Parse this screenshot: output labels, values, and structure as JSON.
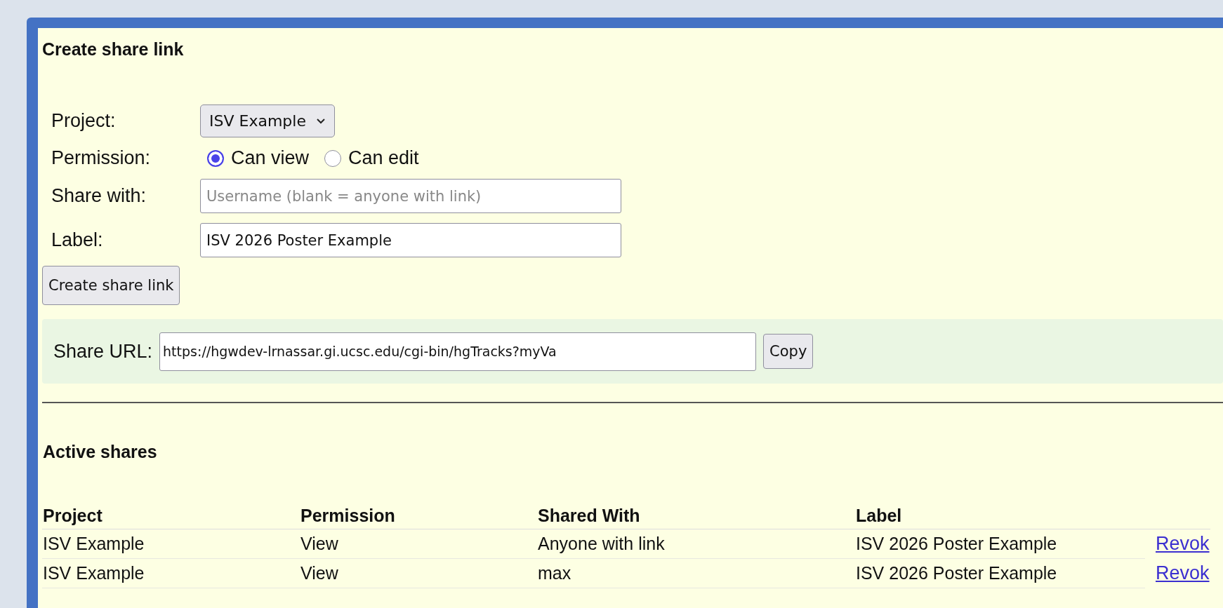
{
  "create_section": {
    "title": "Create share link",
    "project": {
      "label": "Project:",
      "value": "ISV Example"
    },
    "permission": {
      "label": "Permission:",
      "options": [
        {
          "label": "Can view",
          "selected": true
        },
        {
          "label": "Can edit",
          "selected": false
        }
      ]
    },
    "share_with": {
      "label": "Share with:",
      "placeholder": "Username (blank = anyone with link)"
    },
    "share_label": {
      "label": "Label:",
      "value": "ISV 2026 Poster Example"
    },
    "create_button": "Create share link"
  },
  "share_url": {
    "label": "Share URL:",
    "value": "https://hgwdev-lrnassar.gi.ucsc.edu/cgi-bin/hgTracks?myVa",
    "copy_button": "Copy"
  },
  "active_shares": {
    "title": "Active shares",
    "columns": [
      "Project",
      "Permission",
      "Shared With",
      "Label"
    ],
    "rows": [
      {
        "cells": [
          "ISV Example",
          "View",
          "Anyone with link",
          "ISV 2026 Poster Example"
        ],
        "action": "Revok"
      },
      {
        "cells": [
          "ISV Example",
          "View",
          "max",
          "ISV 2026 Poster Example"
        ],
        "action": "Revok"
      }
    ]
  }
}
